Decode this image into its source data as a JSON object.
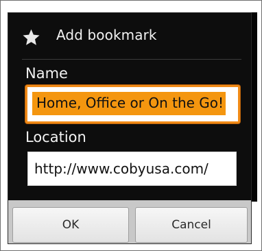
{
  "dialog": {
    "title": "Add bookmark",
    "title_icon": "star-icon",
    "name_label": "Name",
    "name_value": "Home, Office or On the Go!",
    "location_label": "Location",
    "location_value": "http://www.cobyusa.com/",
    "ok_label": "OK",
    "cancel_label": "Cancel"
  },
  "colors": {
    "dialog_background": "#0d0d0d",
    "selection_highlight": "#f4960f",
    "focus_border": "#f08a17",
    "button_bar": "#c8c8c8"
  }
}
